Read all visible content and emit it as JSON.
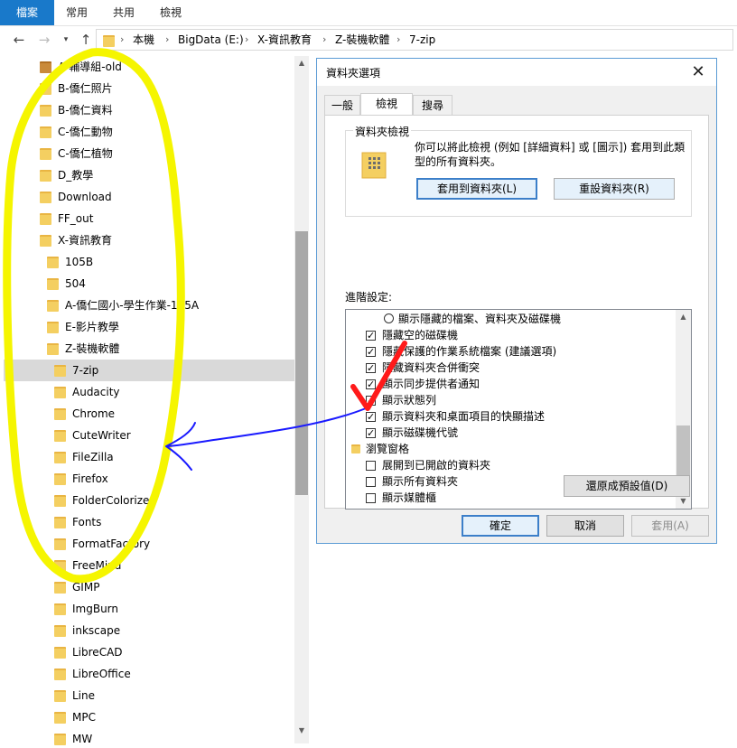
{
  "ribbon": {
    "tabs": [
      "檔案",
      "常用",
      "共用",
      "檢視"
    ]
  },
  "address": {
    "back_icon": "arrow-left-icon",
    "forward_icon": "arrow-right-icon",
    "recent_icon": "chevron-down-icon",
    "up_icon": "arrow-up-icon",
    "crumbs": [
      "本機",
      "BigData (E:)",
      "X-資訊教育",
      "Z-裝機軟體",
      "7-zip"
    ],
    "separator": "›"
  },
  "tree": {
    "items": [
      {
        "label": "A-輔導組-old"
      },
      {
        "label": "B-僑仁照片"
      },
      {
        "label": "B-僑仁資料"
      },
      {
        "label": "C-僑仁動物"
      },
      {
        "label": "C-僑仁植物"
      },
      {
        "label": "D_教學"
      },
      {
        "label": "Download"
      },
      {
        "label": "FF_out"
      },
      {
        "label": "X-資訊教育"
      },
      {
        "label": "105B"
      },
      {
        "label": "504"
      },
      {
        "label": "A-僑仁國小-學生作業-105A"
      },
      {
        "label": "E-影片教學"
      },
      {
        "label": "Z-裝機軟體"
      },
      {
        "label": "7-zip"
      },
      {
        "label": "Audacity"
      },
      {
        "label": "Chrome"
      },
      {
        "label": "CuteWriter"
      },
      {
        "label": "FileZilla"
      },
      {
        "label": "Firefox"
      },
      {
        "label": "FolderColorizer"
      },
      {
        "label": "Fonts"
      },
      {
        "label": "FormatFactory"
      },
      {
        "label": "FreeMind"
      },
      {
        "label": "GIMP"
      },
      {
        "label": "ImgBurn"
      },
      {
        "label": "inkscape"
      },
      {
        "label": "LibreCAD"
      },
      {
        "label": "LibreOffice"
      },
      {
        "label": "Line"
      },
      {
        "label": "MPC"
      },
      {
        "label": "MW"
      }
    ],
    "selected": "7-zip"
  },
  "dialog": {
    "title": "資料夾選項",
    "close_label": "✕",
    "tabs": [
      "一般",
      "檢視",
      "搜尋"
    ],
    "active_tab": "檢視",
    "folder_views": {
      "legend": "資料夾檢視",
      "description_line1": "你可以將此檢視 (例如 [詳細資料] 或 [圖示]) 套用到此類",
      "description_line2": "型的所有資料夾。",
      "apply_button": "套用到資料夾(L)",
      "reset_button": "重設資料夾(R)"
    },
    "advanced_label": "進階設定:",
    "advanced_items": [
      {
        "type": "radio",
        "label": "顯示隱藏的檔案、資料夾及磁碟機",
        "checked": false
      },
      {
        "type": "checkbox",
        "label": "隱藏空的磁碟機",
        "checked": true
      },
      {
        "type": "checkbox",
        "label": "隱藏保護的作業系統檔案 (建議選項)",
        "checked": true
      },
      {
        "type": "checkbox",
        "label": "隱藏資料夾合併衝突",
        "checked": true
      },
      {
        "type": "checkbox",
        "label": "顯示同步提供者通知",
        "checked": true
      },
      {
        "type": "checkbox",
        "label": "顯示狀態列",
        "checked": true
      },
      {
        "type": "checkbox",
        "label": "顯示資料夾和桌面項目的快顯描述",
        "checked": true
      },
      {
        "type": "checkbox",
        "label": "顯示磁碟機代號",
        "checked": true
      },
      {
        "type": "group",
        "label": "瀏覽窗格"
      },
      {
        "type": "checkbox",
        "label": "展開到已開啟的資料夾",
        "checked": false
      },
      {
        "type": "checkbox",
        "label": "顯示所有資料夾",
        "checked": false
      },
      {
        "type": "checkbox",
        "label": "顯示媒體櫃",
        "checked": false
      }
    ],
    "restore_button": "還原成預設值(D)",
    "ok_button": "確定",
    "cancel_button": "取消",
    "apply_button": "套用(A)"
  },
  "colors": {
    "file_tab": "#1979ca",
    "folder": "#f4cf61",
    "annotation_yellow": "#f5f500",
    "annotation_blue": "#1a1aff",
    "annotation_red": "#ff1a1a"
  }
}
